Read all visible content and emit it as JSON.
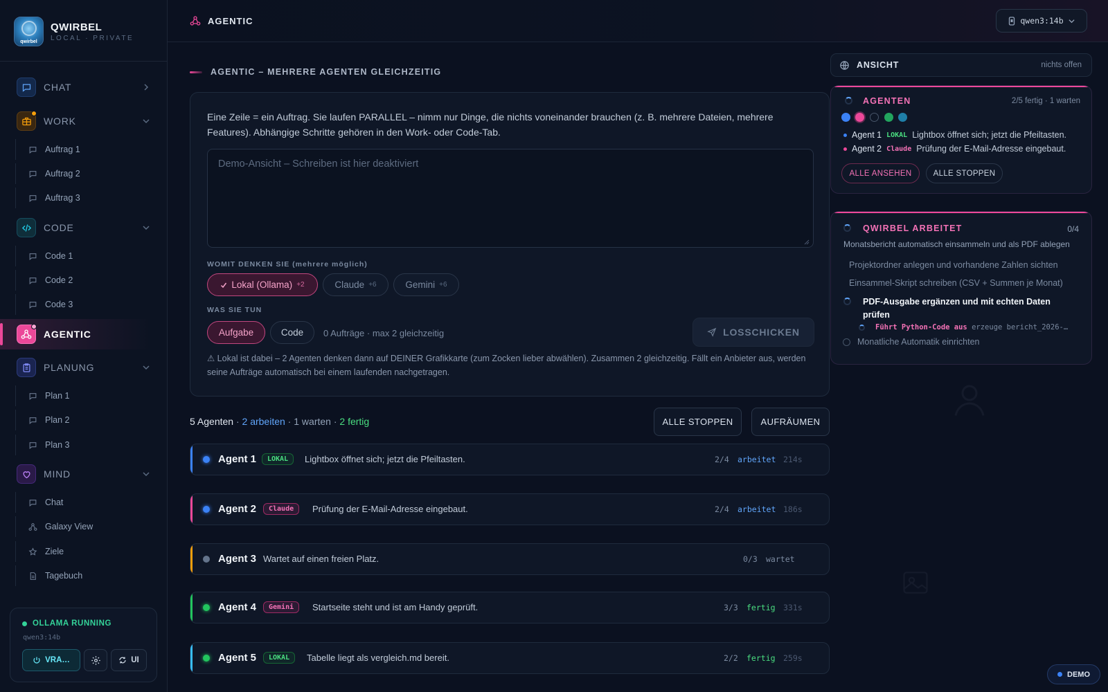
{
  "brand": {
    "title": "QWIRBEL",
    "subtitle": "LOCAL · PRIVATE",
    "logo_text": "qwirbel"
  },
  "sidebar": {
    "sections": [
      {
        "label": "CHAT",
        "icon": "chat-icon"
      },
      {
        "label": "WORK",
        "icon": "briefcase-icon",
        "items": [
          "Auftrag 1",
          "Auftrag 2",
          "Auftrag 3"
        ]
      },
      {
        "label": "CODE",
        "icon": "code-icon",
        "items": [
          "Code 1",
          "Code 2",
          "Code 3"
        ]
      },
      {
        "label": "AGENTIC",
        "icon": "network-icon"
      },
      {
        "label": "PLANUNG",
        "icon": "clipboard-icon",
        "items": [
          "Plan 1",
          "Plan 2",
          "Plan 3"
        ]
      },
      {
        "label": "MIND",
        "icon": "heart-icon",
        "items": [
          "Chat",
          "Galaxy View",
          "Ziele",
          "Tagebuch"
        ]
      }
    ],
    "status": {
      "title": "OLLAMA RUNNING",
      "model": "qwen3:14b",
      "btn_vram": "VRA…",
      "btn_ui": "UI"
    }
  },
  "header": {
    "title": "AGENTIC",
    "model": "qwen3:14b"
  },
  "main": {
    "section_title": "AGENTIC – MEHRERE AGENTEN GLEICHZEITIG",
    "intro": "Eine Zeile = ein Auftrag. Sie laufen PARALLEL – nimm nur Dinge, die nichts voneinander brauchen (z. B. mehrere Dateien, mehrere Features). Abhängige Schritte gehören in den Work- oder Code-Tab.",
    "placeholder": "Demo-Ansicht – Schreiben ist hier deaktiviert",
    "think_label": "WOMIT DENKEN SIE (mehrere möglich)",
    "providers": [
      {
        "label": "Lokal (Ollama)",
        "extra": "+2",
        "selected": true
      },
      {
        "label": "Claude",
        "extra": "+6",
        "selected": false
      },
      {
        "label": "Gemini",
        "extra": "+6",
        "selected": false
      }
    ],
    "do_label": "WAS SIE TUN",
    "modes": [
      {
        "label": "Aufgabe",
        "selected": true
      },
      {
        "label": "Code",
        "selected": false
      }
    ],
    "counter": "0 Aufträge · max 2 gleichzeitig",
    "send": "LOSSCHICKEN",
    "warning": "⚠ Lokal ist dabei – 2 Agenten denken dann auf DEINER Grafikkarte (zum Zocken lieber abwählen). Zusammen 2 gleichzeitig. Fällt ein Anbieter aus, werden seine Aufträge automatisch bei einem laufenden nachgetragen.",
    "summary": {
      "agents": "5 Agenten",
      "sep": " · ",
      "working": "2 arbeiten",
      "waiting": "1 warten",
      "done": "2 fertig"
    },
    "stop_all": "ALLE STOPPEN",
    "cleanup": "AUFRÄUMEN",
    "agents": [
      {
        "name": "Agent 1",
        "badge": "LOKAL",
        "msg": "Lightbox öffnet sich; jetzt die Pfeiltasten.",
        "progress": "2/4",
        "state": "arbeitet",
        "time": "214s"
      },
      {
        "name": "Agent 2",
        "badge": "Claude",
        "msg": "Prüfung der E-Mail-Adresse eingebaut.",
        "progress": "2/4",
        "state": "arbeitet",
        "time": "186s"
      },
      {
        "name": "Agent 3",
        "badge": "",
        "msg": "Wartet auf einen freien Platz.",
        "progress": "0/3",
        "state": "wartet",
        "time": ""
      },
      {
        "name": "Agent 4",
        "badge": "Gemini",
        "msg": "Startseite steht und ist am Handy geprüft.",
        "progress": "3/3",
        "state": "fertig",
        "time": "331s"
      },
      {
        "name": "Agent 5",
        "badge": "LOKAL",
        "msg": "Tabelle liegt als vergleich.md bereit.",
        "progress": "2/2",
        "state": "fertig",
        "time": "259s"
      }
    ]
  },
  "right": {
    "view": {
      "title": "ANSICHT",
      "status": "nichts offen"
    },
    "agents_panel": {
      "title": "AGENTEN",
      "status": "2/5 fertig · 1 warten",
      "lines": [
        {
          "name": "Agent 1",
          "badge": "LOKAL",
          "msg": "Lightbox öffnet sich; jetzt die Pfeiltasten."
        },
        {
          "name": "Agent 2",
          "badge": "Claude",
          "msg": "Prüfung der E-Mail-Adresse eingebaut."
        }
      ],
      "view_all": "ALLE ANSEHEN",
      "stop_all": "ALLE STOPPEN"
    },
    "work_panel": {
      "title": "QWIRBEL ARBEITET",
      "count": "0/4",
      "subtitle": "Monatsbericht automatisch einsammeln und als PDF ablegen",
      "tasks_done": [
        "Projektordner anlegen und vorhandene Zahlen sichten",
        "Einsammel-Skript schreiben (CSV + Summen je Monat)"
      ],
      "task_active": "PDF-Ausgabe ergänzen und mit echten Daten prüfen",
      "tool_label": "Führt Python-Code aus",
      "tool_arg": "erzeuge bericht_2026-…",
      "task_pending": "Monatliche Automatik einrichten"
    }
  },
  "demo": "DEMO",
  "colors": {
    "accent": "#ec4899",
    "working": "#60a5fa",
    "done": "#4ade80",
    "waiting": "#f59e0b",
    "bg": "#0b1120"
  }
}
